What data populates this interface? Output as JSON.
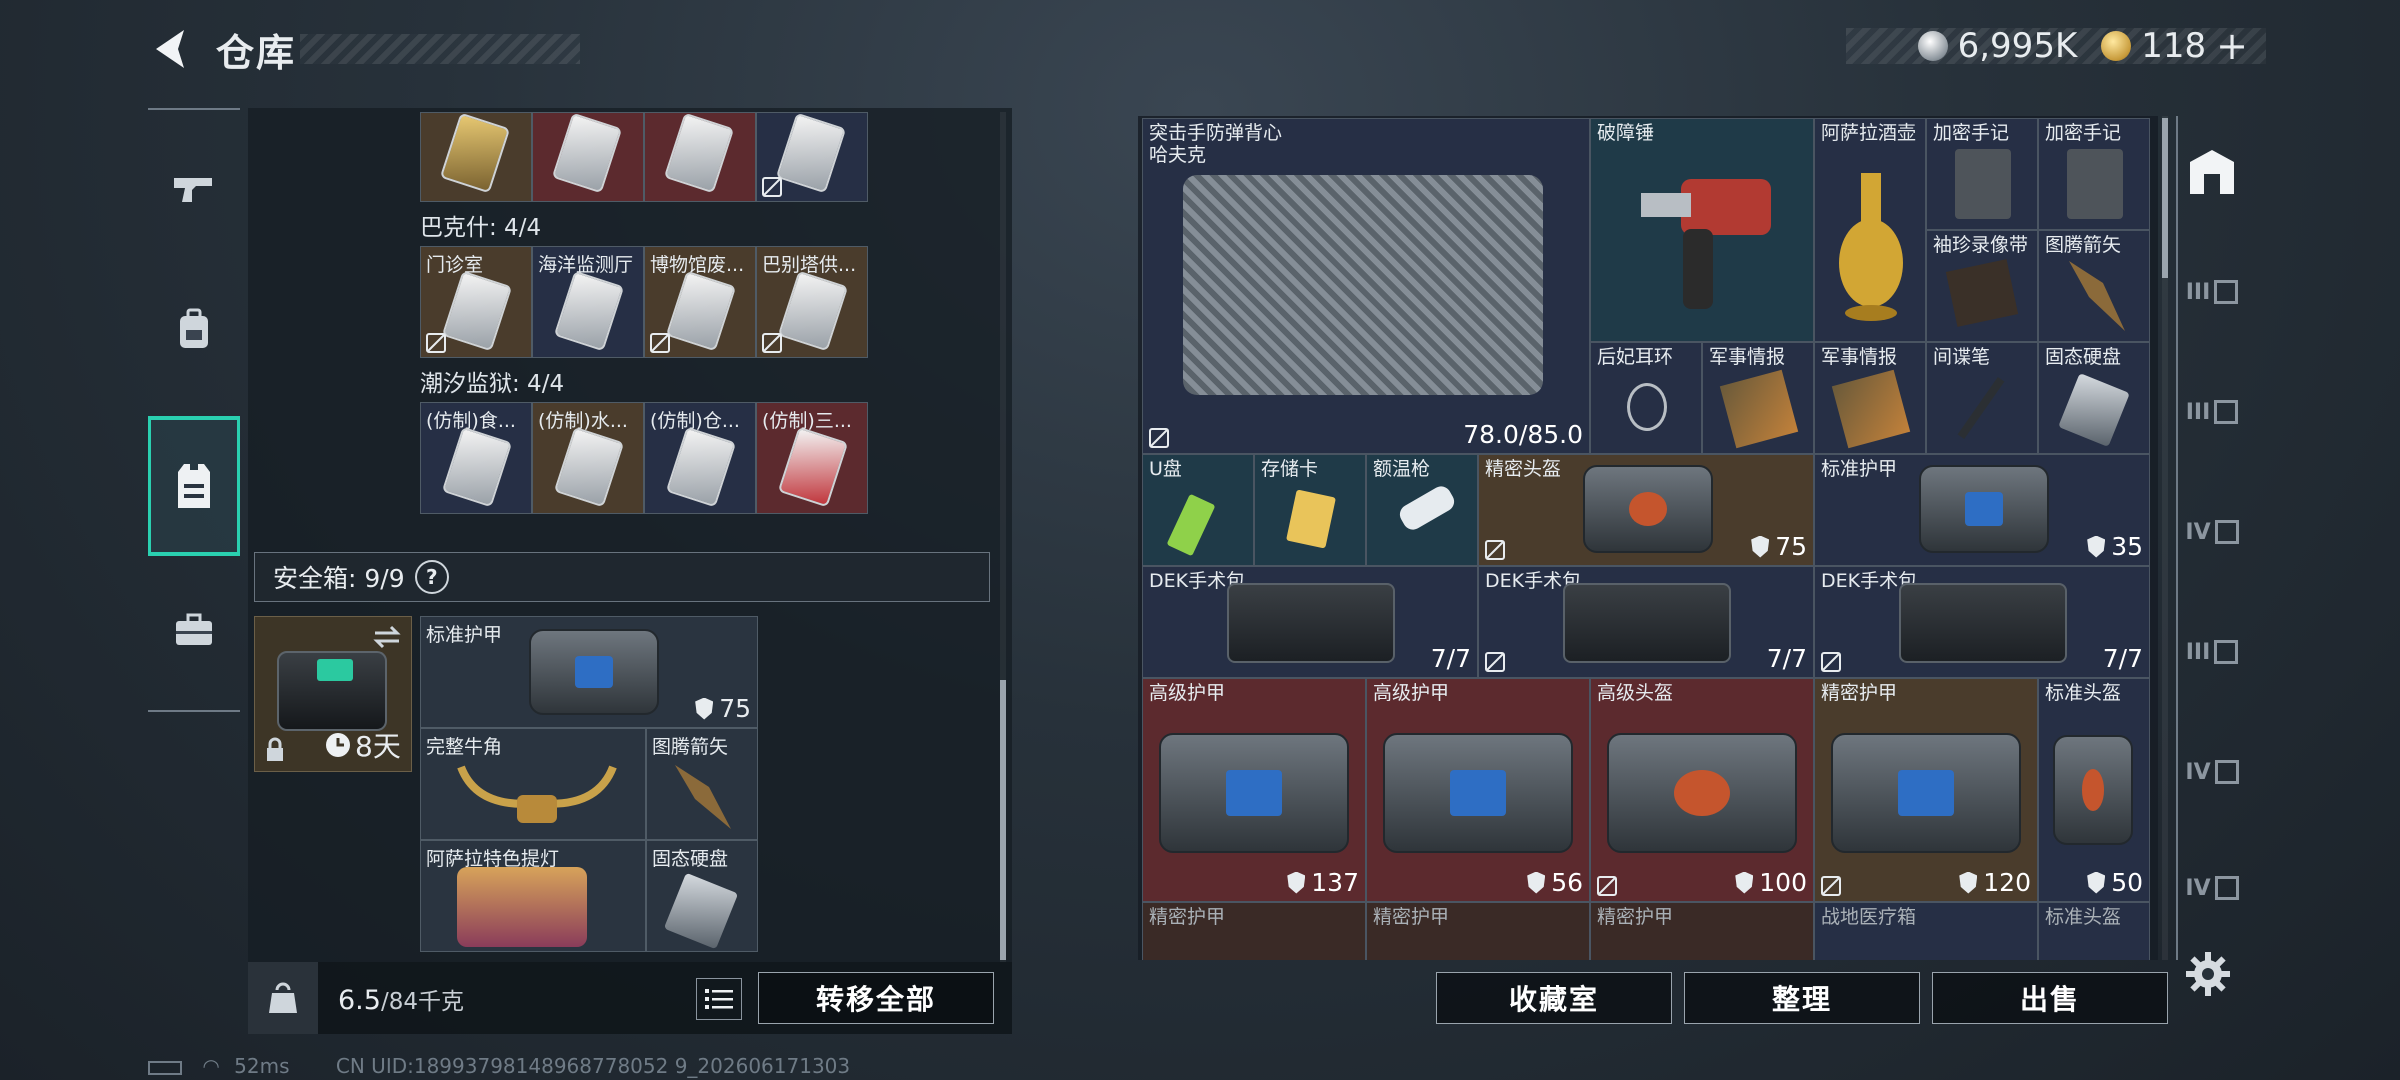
{
  "header": {
    "title": "仓库",
    "currency_silver": "6,995K",
    "currency_gold": "118"
  },
  "left_nav": [
    {
      "icon": "pistol-icon"
    },
    {
      "icon": "backpack-icon"
    },
    {
      "icon": "vest-icon",
      "active": true
    },
    {
      "icon": "toolbox-icon"
    }
  ],
  "collections": [
    {
      "label": "巴克什: 4/4",
      "cards": [
        "门诊室",
        "海洋监测厅",
        "博物馆废...",
        "巴别塔供..."
      ]
    },
    {
      "label": "潮汐监狱: 4/4",
      "cards": [
        "(仿制)食...",
        "(仿制)水...",
        "(仿制)仓...",
        "(仿制)三..."
      ]
    }
  ],
  "safe_box": {
    "label": "安全箱: 9/9",
    "help": "?",
    "duration": "8天",
    "items": [
      {
        "name": "标准护甲",
        "value": "75"
      },
      {
        "name": "完整牛角",
        "value": ""
      },
      {
        "name": "图腾箭矢",
        "value": ""
      },
      {
        "name": "阿萨拉特色提灯",
        "value": ""
      },
      {
        "name": "固态硬盘",
        "value": ""
      }
    ]
  },
  "footer_left": {
    "weight_current": "6.5",
    "weight_max": "/84千克",
    "transfer_all": "转移全部"
  },
  "stash": {
    "vest_name_1": "突击手防弹背心",
    "vest_name_2": "哈夫克",
    "vest_durability": "78.0/85.0",
    "items": [
      {
        "name": "破障锤",
        "value": ""
      },
      {
        "name": "阿萨拉酒壶",
        "value": ""
      },
      {
        "name": "加密手记",
        "value": ""
      },
      {
        "name": "加密手记",
        "value": ""
      },
      {
        "name": "袖珍录像带",
        "value": ""
      },
      {
        "name": "图腾箭矢",
        "value": ""
      },
      {
        "name": "后妃耳环",
        "value": ""
      },
      {
        "name": "军事情报",
        "value": ""
      },
      {
        "name": "军事情报",
        "value": ""
      },
      {
        "name": "间谍笔",
        "value": ""
      },
      {
        "name": "固态硬盘",
        "value": ""
      },
      {
        "name": "U盘",
        "value": ""
      },
      {
        "name": "存储卡",
        "value": ""
      },
      {
        "name": "额温枪",
        "value": ""
      },
      {
        "name": "精密头盔",
        "value": "75"
      },
      {
        "name": "标准护甲",
        "value": "35"
      },
      {
        "name": "DEK手术包",
        "value": "7/7"
      },
      {
        "name": "DEK手术包",
        "value": "7/7"
      },
      {
        "name": "DEK手术包",
        "value": "7/7"
      },
      {
        "name": "高级护甲",
        "value": "137"
      },
      {
        "name": "高级护甲",
        "value": "56"
      },
      {
        "name": "高级头盔",
        "value": "100"
      },
      {
        "name": "精密护甲",
        "value": "120"
      },
      {
        "name": "标准头盔",
        "value": "50"
      },
      {
        "name": "精密护甲",
        "value": ""
      },
      {
        "name": "精密护甲",
        "value": ""
      },
      {
        "name": "精密护甲",
        "value": ""
      },
      {
        "name": "战地医疗箱",
        "value": ""
      },
      {
        "name": "标准头盔",
        "value": ""
      }
    ]
  },
  "right_buttons": {
    "collection_room": "收藏室",
    "organize": "整理",
    "sell": "出售"
  },
  "right_nav": [
    {
      "label": ""
    },
    {
      "label": "III"
    },
    {
      "label": "III"
    },
    {
      "label": "IV"
    },
    {
      "label": "III"
    },
    {
      "label": "IV"
    },
    {
      "label": "IV"
    }
  ],
  "status": {
    "ping": "52ms",
    "uid": "CN UID:18993798148968778052 9_202606171303"
  }
}
